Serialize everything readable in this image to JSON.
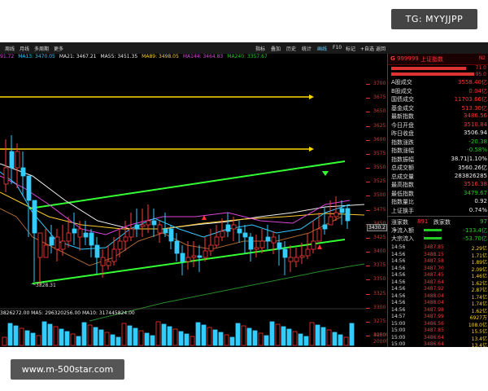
{
  "watermark": {
    "tg": "TG: MYYJJPP",
    "url": "www.m-500star.com"
  },
  "toolbar": {
    "left": [
      "周线",
      "月线",
      "多周期",
      "更多"
    ],
    "right": [
      "指标",
      "叠加",
      "历史",
      "统计",
      "画线",
      "F10",
      "标记",
      "+自选",
      "返回"
    ]
  },
  "ma_bar": [
    {
      "label": "91.72",
      "color": "#d4d"
    },
    {
      "label": "MA13: 3470.05",
      "color": "#3cf"
    },
    {
      "label": "MA21: 3467.21",
      "color": "#eee"
    },
    {
      "label": "MA55: 3451.35",
      "color": "#eee"
    },
    {
      "label": "MA89: 3498.05",
      "color": "#fc3"
    },
    {
      "label": "MA144: 3464.83",
      "color": "#d4d"
    },
    {
      "label": "MA240: 3357.67",
      "color": "#2c2"
    }
  ],
  "chart": {
    "y_ticks": [
      "3700",
      "3675",
      "3650",
      "3625",
      "3600",
      "3575",
      "3550",
      "3525",
      "3500",
      "3475",
      "3450",
      "3425",
      "3400",
      "3375",
      "3350",
      "3325",
      "3300",
      "3275",
      "3250"
    ],
    "current_price_label": "3430.2",
    "low_label": "3328.31",
    "volume_label": "3826272.00 MA5: 296320256.00 MA10: 317445824.00",
    "volume_ticks": [
      "40000",
      "20000",
      "百万"
    ]
  },
  "panel": {
    "header": {
      "code": "999999",
      "name": "上证指数",
      "badge": "N2",
      "top_values": [
        "71.0",
        "95.0"
      ]
    },
    "stats": [
      {
        "label": "A股成交",
        "value": "3558.40亿",
        "color": "#f33"
      },
      {
        "label": "B股成交",
        "value": "0.04亿",
        "color": "#f33"
      },
      {
        "label": "国债成交",
        "value": "11703.66亿",
        "color": "#f33"
      },
      {
        "label": "基金成交",
        "value": "513.30亿",
        "color": "#f33"
      },
      {
        "label": "最新指数",
        "value": "3486.56",
        "color": "#f33"
      },
      {
        "label": "今日开盘",
        "value": "3510.84",
        "color": "#f33"
      },
      {
        "label": "昨日收盘",
        "value": "3506.94",
        "color": "#eee"
      },
      {
        "label": "指数涨跌",
        "value": "-20.38",
        "color": "#2c2"
      },
      {
        "label": "指数涨幅",
        "value": "-0.58%",
        "color": "#2c2"
      },
      {
        "label": "指数振幅",
        "value": "38.71|1.10%",
        "color": "#eee"
      },
      {
        "label": "总成交额",
        "value": "3560.26亿",
        "color": "#eee"
      },
      {
        "label": "总成交量",
        "value": "283826285",
        "color": "#eee"
      },
      {
        "label": "最高指数",
        "value": "3516.38",
        "color": "#f33"
      },
      {
        "label": "最低指数",
        "value": "3479.67",
        "color": "#2c2"
      },
      {
        "label": "指数量比",
        "value": "0.92",
        "color": "#eee"
      },
      {
        "label": "上证换手",
        "value": "0.74%",
        "color": "#eee"
      }
    ],
    "up_down": {
      "up_label": "涨家数",
      "up_value": "891",
      "down_label": "跌家数",
      "down_value": "97"
    },
    "flows": [
      {
        "label": "净流入额",
        "value": "-133.4亿",
        "color": "#2c2"
      },
      {
        "label": "大宗流入",
        "value": "-53.70亿",
        "color": "#2c2"
      }
    ],
    "ticks": [
      {
        "time": "14:56",
        "price": "3487.85",
        "vol": "2.29亿"
      },
      {
        "time": "14:56",
        "price": "3488.15",
        "vol": "1.71亿"
      },
      {
        "time": "14:56",
        "price": "3487.58",
        "vol": "1.89亿"
      },
      {
        "time": "14:56",
        "price": "3487.70",
        "vol": "2.09亿"
      },
      {
        "time": "14:56",
        "price": "3487.45",
        "vol": "1.46亿"
      },
      {
        "time": "14:56",
        "price": "3487.64",
        "vol": "1.62亿"
      },
      {
        "time": "14:56",
        "price": "3487.92",
        "vol": "2.87亿"
      },
      {
        "time": "14:56",
        "price": "3488.04",
        "vol": "1.74亿"
      },
      {
        "time": "14:56",
        "price": "3488.04",
        "vol": "1.74亿"
      },
      {
        "time": "14:56",
        "price": "3487.98",
        "vol": "1.62亿"
      },
      {
        "time": "14:57",
        "price": "3487.99",
        "vol": "6927万"
      },
      {
        "time": "15:00",
        "price": "3486.56",
        "vol": "108.0亿"
      },
      {
        "time": "15:00",
        "price": "3487.85",
        "vol": "15.5亿"
      },
      {
        "time": "15:00",
        "price": "3486.64",
        "vol": "13.4亿"
      },
      {
        "time": "15:00",
        "price": "3486.64",
        "vol": "13.4亿"
      }
    ]
  }
}
